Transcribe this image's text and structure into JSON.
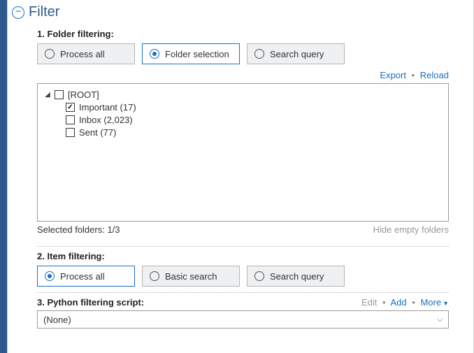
{
  "header": {
    "title": "Filter"
  },
  "folder_filtering": {
    "label": "1. Folder filtering:",
    "options": {
      "process_all": "Process all",
      "folder_selection": "Folder selection",
      "search_query": "Search query"
    },
    "links": {
      "export": "Export",
      "reload": "Reload"
    },
    "tree": {
      "root": "[ROOT]",
      "items": [
        {
          "label": "Important (17)",
          "checked": true
        },
        {
          "label": "Inbox (2,023)",
          "checked": false
        },
        {
          "label": "Sent (77)",
          "checked": false
        }
      ]
    },
    "status": "Selected folders: 1/3",
    "hide_empty": "Hide empty folders"
  },
  "item_filtering": {
    "label": "2. Item filtering:",
    "options": {
      "process_all": "Process all",
      "basic_search": "Basic search",
      "search_query": "Search query"
    }
  },
  "script": {
    "label": "3. Python filtering script:",
    "links": {
      "edit": "Edit",
      "add": "Add",
      "more": "More"
    },
    "selected": "(None)"
  }
}
